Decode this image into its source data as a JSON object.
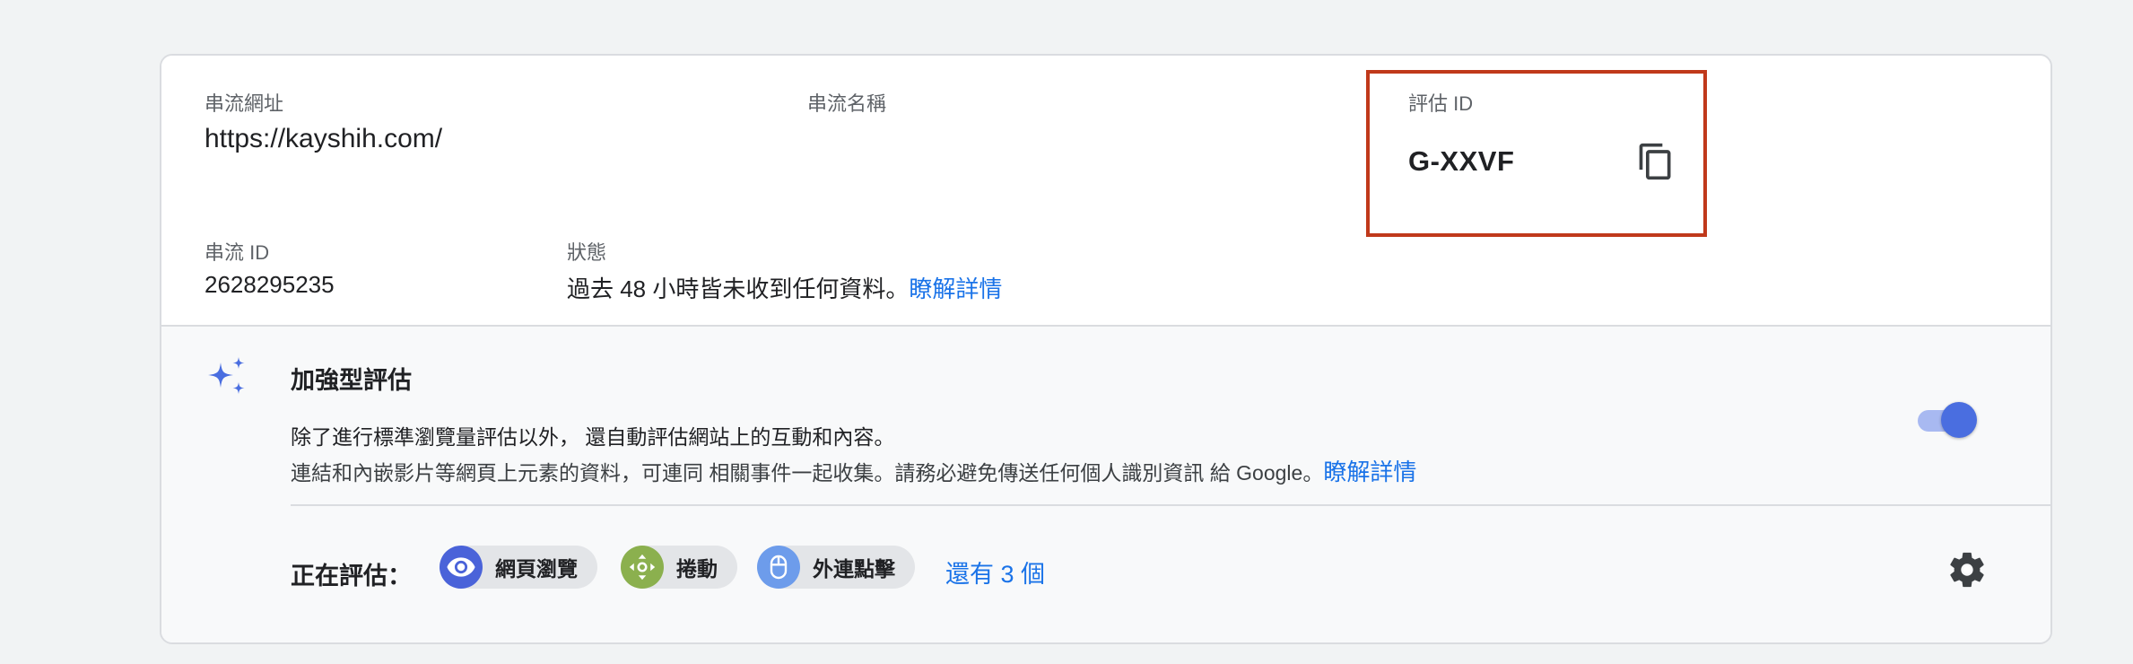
{
  "stream": {
    "url_label": "串流網址",
    "url_value": "https://kayshih.com/",
    "name_label": "串流名稱",
    "name_value": "",
    "measurement_label": "評估 ID",
    "measurement_value": "G-XXVF",
    "id_label": "串流 ID",
    "id_value": "2628295235",
    "status_label": "狀態",
    "status_text": "過去 48 小時皆未收到任何資料。",
    "status_link": "瞭解詳情"
  },
  "enhanced": {
    "title": "加強型評估",
    "desc1": "除了進行標準瀏覽量評估以外， 還自動評估網站上的互動和內容。",
    "desc2": "連結和內嵌影片等網頁上元素的資料，可連同 相關事件一起收集。請務必避免傳送任何個人識別資訊 給 Google。",
    "desc2_link": "瞭解詳情",
    "toggle_on": true,
    "measuring_label": "正在評估：",
    "chips": [
      {
        "label": "網頁瀏覽",
        "icon": "eye-icon",
        "color": "#4a63d9"
      },
      {
        "label": "捲動",
        "icon": "scroll-icon",
        "color": "#8bb04e"
      },
      {
        "label": "外連點擊",
        "icon": "mouse-icon",
        "color": "#6d9ceb"
      }
    ],
    "more_link": "還有 3 個"
  },
  "colors": {
    "highlight": "#c0391b",
    "link": "#1a73e8",
    "toggle": "#4a6ee0"
  }
}
